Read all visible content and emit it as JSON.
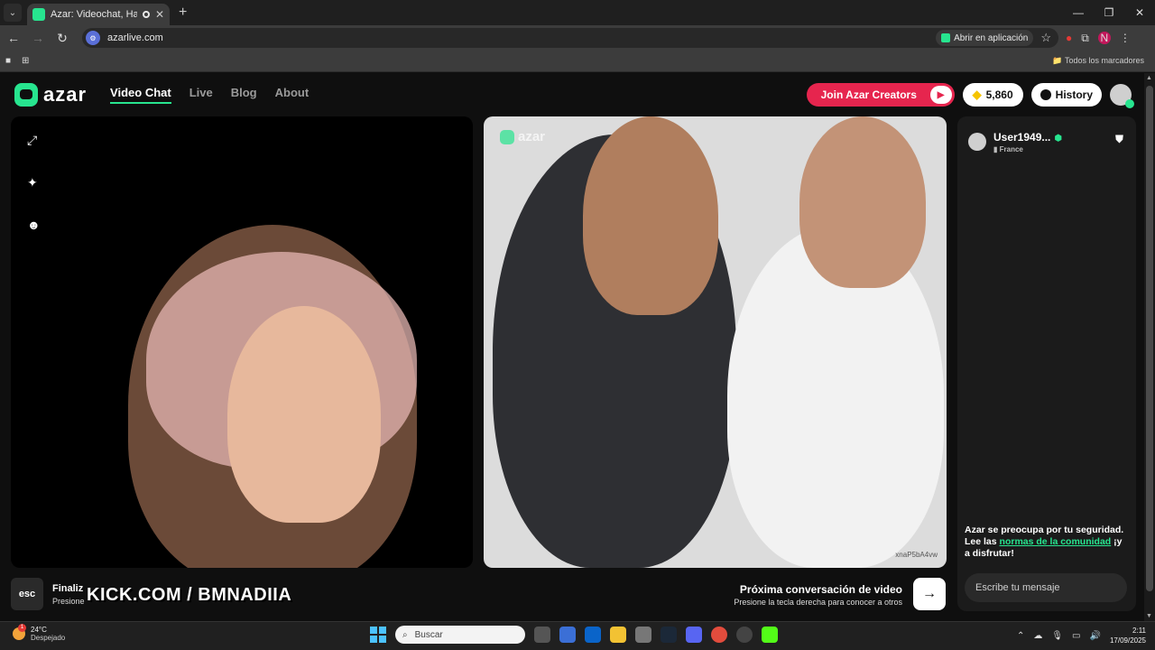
{
  "browser": {
    "tab_title": "Azar: Videochat, Haz nuevos",
    "url": "azarlive.com",
    "open_in_app": "Abrir en aplicación",
    "all_bookmarks": "Todos los marcadores",
    "profile_initial": "N"
  },
  "header": {
    "logo_text": "azar",
    "nav": [
      {
        "label": "Video Chat",
        "active": true
      },
      {
        "label": "Live"
      },
      {
        "label": "Blog"
      },
      {
        "label": "About"
      }
    ],
    "creators_label": "Join Azar Creators",
    "gems": "5,860",
    "history_label": "History"
  },
  "video_right": {
    "watermark": "azar",
    "code": "xnaP5bA4vw"
  },
  "chat": {
    "peer_name": "User1949...",
    "peer_country": "France",
    "safety_prefix": "Azar se preocupa por tu seguridad. Lee las ",
    "safety_link": "normas de la comunidad",
    "safety_suffix": " ¡y a disfrutar!",
    "input_placeholder": "Escribe tu mensaje"
  },
  "bottom": {
    "esc_label": "esc",
    "end_title": "Finaliz",
    "end_sub": "Presione",
    "overlay_text": "KICK.COM / BMNADIIA",
    "next_title": "Próxima conversación de video",
    "next_sub": "Presione la tecla derecha para conocer a otros"
  },
  "taskbar": {
    "temperature": "24°C",
    "condition": "Despejado",
    "weather_badge": "1",
    "search_placeholder": "Buscar",
    "time": "2:11",
    "date": "17/09/2025"
  },
  "colors": {
    "brand_green": "#27e58f",
    "creators_red": "#e6254e",
    "gem_yellow": "#f5c400"
  },
  "icons": [
    "expand-icon",
    "sparkle-icon",
    "emoji-icon",
    "gem-icon",
    "clock-icon",
    "shield-icon",
    "arrow-right-icon"
  ]
}
